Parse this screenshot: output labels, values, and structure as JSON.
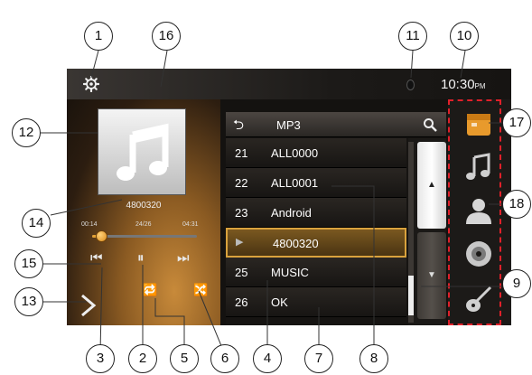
{
  "status": {
    "clock_time": "10:30",
    "clock_suffix": "PM"
  },
  "player": {
    "song_id": "4800320",
    "elapsed": "00:14",
    "track_position": "24/26",
    "total": "04:31",
    "progress": 0.05
  },
  "list": {
    "header_title": "MP3",
    "rows": [
      {
        "num": "21",
        "name": "ALL0000"
      },
      {
        "num": "22",
        "name": "ALL0001"
      },
      {
        "num": "23",
        "name": "Android"
      },
      {
        "num": "▶",
        "name": "4800320"
      },
      {
        "num": "25",
        "name": "MUSIC"
      },
      {
        "num": "26",
        "name": "OK"
      }
    ],
    "active_index": 3
  },
  "sidebar_icons": [
    "folder-icon",
    "music-note-icon",
    "contacts-icon",
    "disc-icon",
    "guitar-icon"
  ],
  "callouts": [
    "1",
    "2",
    "3",
    "4",
    "5",
    "6",
    "7",
    "8",
    "9",
    "10",
    "11",
    "12",
    "13",
    "14",
    "15",
    "16",
    "17",
    "18"
  ],
  "colors": {
    "accent": "#d9a23d",
    "highlight_box": "#e0202a"
  }
}
